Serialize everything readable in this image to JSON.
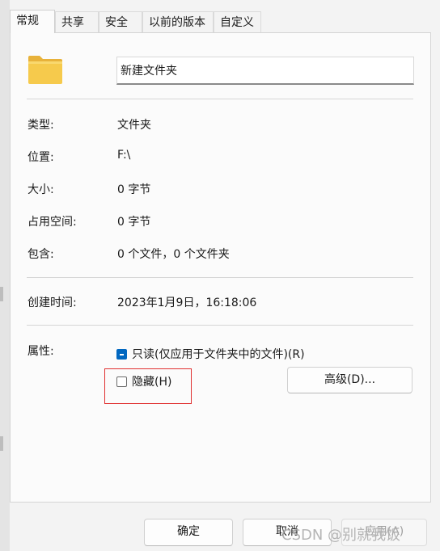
{
  "tabs": [
    {
      "label": "常规",
      "active": true
    },
    {
      "label": "共享"
    },
    {
      "label": "安全"
    },
    {
      "label": "以前的版本"
    },
    {
      "label": "自定义"
    }
  ],
  "folder_name": "新建文件夹",
  "properties": [
    {
      "label": "类型:",
      "value": "文件夹"
    },
    {
      "label": "位置:",
      "value": "F:\\"
    },
    {
      "label": "大小:",
      "value": "0 字节"
    },
    {
      "label": "占用空间:",
      "value": "0 字节"
    },
    {
      "label": "包含:",
      "value": "0 个文件，0 个文件夹"
    }
  ],
  "created": {
    "label": "创建时间:",
    "value": "2023年1月9日，16:18:06"
  },
  "attributes": {
    "label": "属性:",
    "readonly": {
      "label": "只读(仅应用于文件夹中的文件)(R)",
      "state": "indeterminate"
    },
    "hidden": {
      "label": "隐藏(H)",
      "checked": false
    },
    "advanced_button": "高级(D)..."
  },
  "buttons": {
    "ok": "确定",
    "cancel": "取消",
    "apply": "应用(A)"
  },
  "watermark": "CSDN @别就我饭",
  "colors": {
    "accent": "#0067c0",
    "highlight_border": "#e03030",
    "folder": "#f4c542"
  }
}
